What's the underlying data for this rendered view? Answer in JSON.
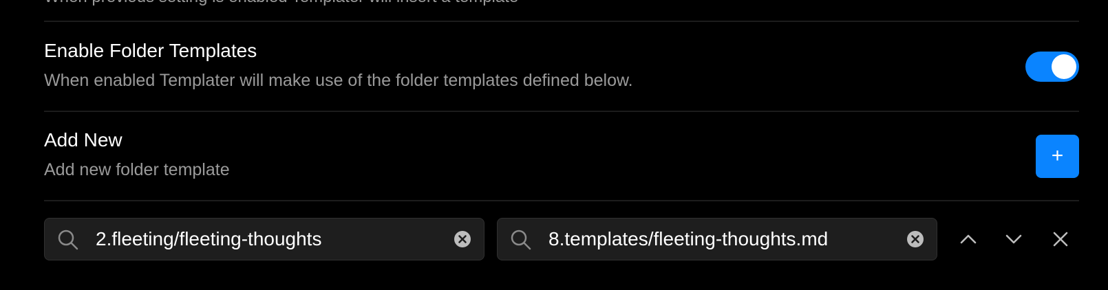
{
  "top_partial_text": "When previous setting is enabled Templater will insert a template",
  "settings": {
    "folder_templates": {
      "name": "Enable Folder Templates",
      "description": "When enabled Templater will make use of the folder templates defined below.",
      "enabled": true
    },
    "add_new": {
      "name": "Add New",
      "description": "Add new folder template",
      "button_label": "+"
    }
  },
  "folder_template_row": {
    "folder": {
      "value": "2.fleeting/fleeting-thoughts",
      "icon": "search-icon"
    },
    "template": {
      "value": "8.templates/fleeting-thoughts.md",
      "icon": "search-icon"
    },
    "actions": [
      "chevron-up-icon",
      "chevron-down-icon",
      "close-icon"
    ]
  },
  "colors": {
    "accent": "#0a84ff",
    "background": "#000000",
    "field_background": "#1e1e1e"
  }
}
